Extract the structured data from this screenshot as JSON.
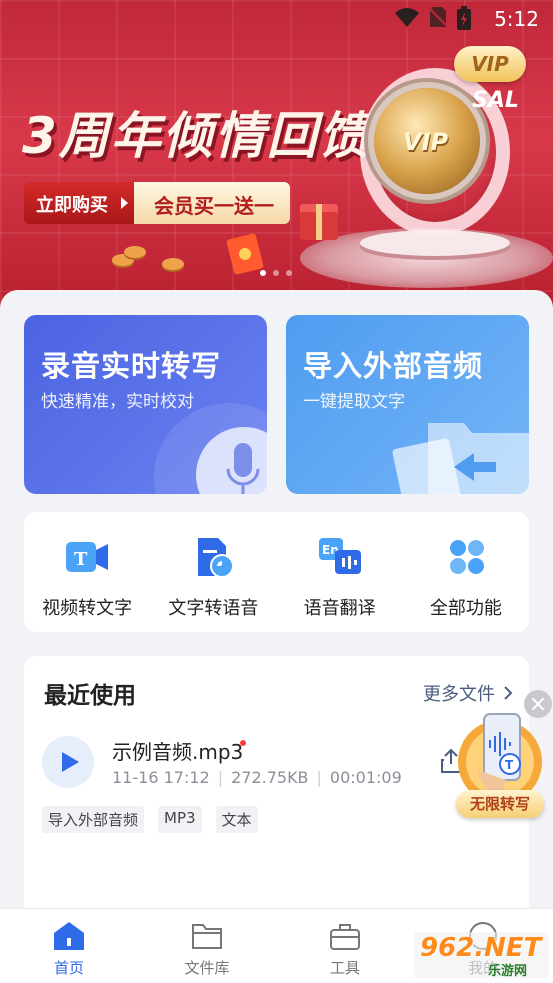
{
  "status_bar": {
    "time": "5:12"
  },
  "banner": {
    "title": "3周年倾情回馈",
    "buy_button": "立即购买",
    "offer": "会员买一送一",
    "vip_badge": "VIP",
    "sale_text": "SAL",
    "medal_text": "VIP",
    "slide_count": 3,
    "active_slide": 1
  },
  "cards": {
    "record": {
      "title": "录音实时转写",
      "subtitle": "快速精准，实时校对"
    },
    "import": {
      "title": "导入外部音频",
      "subtitle": "一键提取文字"
    }
  },
  "tools": [
    {
      "label": "视频转文字",
      "icon": "video-to-text-icon"
    },
    {
      "label": "文字转语音",
      "icon": "text-to-speech-icon"
    },
    {
      "label": "语音翻译",
      "icon": "voice-translate-icon"
    },
    {
      "label": "全部功能",
      "icon": "all-features-icon"
    }
  ],
  "recent": {
    "title": "最近使用",
    "more": "更多文件",
    "files": [
      {
        "name": "示例音频.mp3",
        "date": "11-16 17:12",
        "size": "272.75KB",
        "duration": "00:01:09",
        "tags": [
          "导入外部音频",
          "MP3",
          "文本"
        ]
      }
    ]
  },
  "float_promo": {
    "label": "无限转写"
  },
  "bottom_nav": [
    {
      "label": "首页",
      "active": true
    },
    {
      "label": "文件库",
      "active": false
    },
    {
      "label": "工具",
      "active": false
    },
    {
      "label": "我的",
      "active": false
    }
  ],
  "watermark": {
    "brand": "962.NET",
    "site": "乐游网"
  },
  "colors": {
    "accent": "#2f6ae8",
    "banner_red": "#c0283a",
    "record_card": "#4b63e0",
    "import_card": "#4f9cf0"
  }
}
